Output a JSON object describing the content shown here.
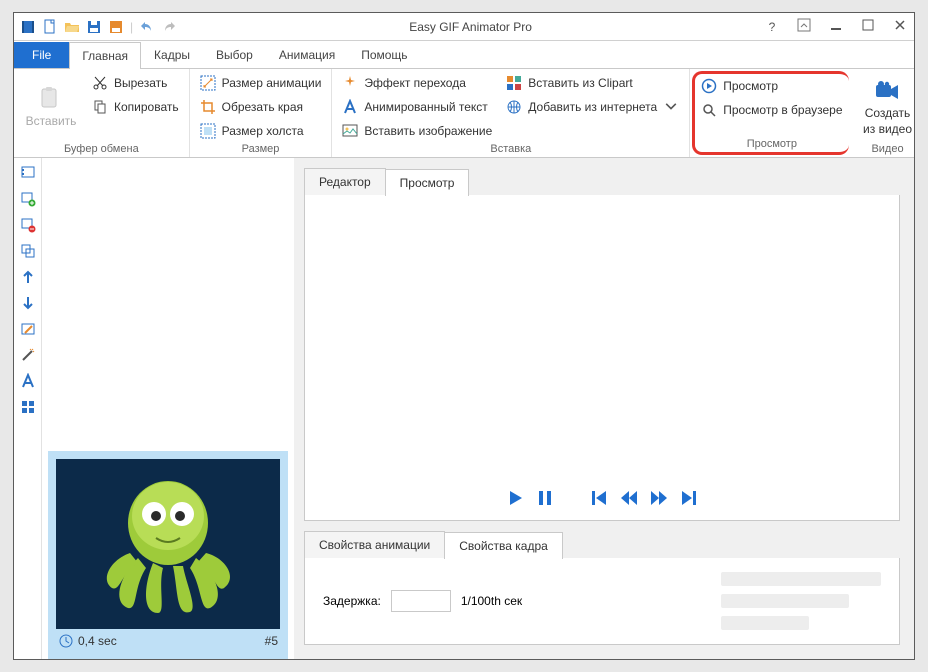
{
  "title": "Easy GIF Animator Pro",
  "file_tab": "File",
  "tabs": [
    "Главная",
    "Кадры",
    "Выбор",
    "Анимация",
    "Помощь"
  ],
  "active_tab": 0,
  "ribbon": {
    "clipboard": {
      "paste": "Вставить",
      "cut": "Вырезать",
      "copy": "Копировать",
      "label": "Буфер обмена"
    },
    "size": {
      "anim_size": "Размер анимации",
      "crop": "Обрезать края",
      "canvas_size": "Размер холста",
      "label": "Размер"
    },
    "insert": {
      "transition": "Эффект перехода",
      "anim_text": "Анимированный текст",
      "insert_image": "Вставить изображение",
      "clipart": "Вставить из Clipart",
      "from_web": "Добавить из интернета",
      "label": "Вставка"
    },
    "preview": {
      "preview": "Просмотр",
      "browser": "Просмотр в браузере",
      "label": "Просмотр"
    },
    "video": {
      "create_l1": "Создать",
      "create_l2": "из видео",
      "label": "Видео"
    }
  },
  "preview_tabs": {
    "editor": "Редактор",
    "preview": "Просмотр"
  },
  "props_tabs": {
    "anim": "Свойства анимации",
    "frame": "Свойства кадра"
  },
  "props": {
    "delay_label": "Задержка:",
    "delay_value": "",
    "delay_unit": "1/100th сек"
  },
  "frame": {
    "duration": "0,4 sec",
    "index": "#5"
  }
}
